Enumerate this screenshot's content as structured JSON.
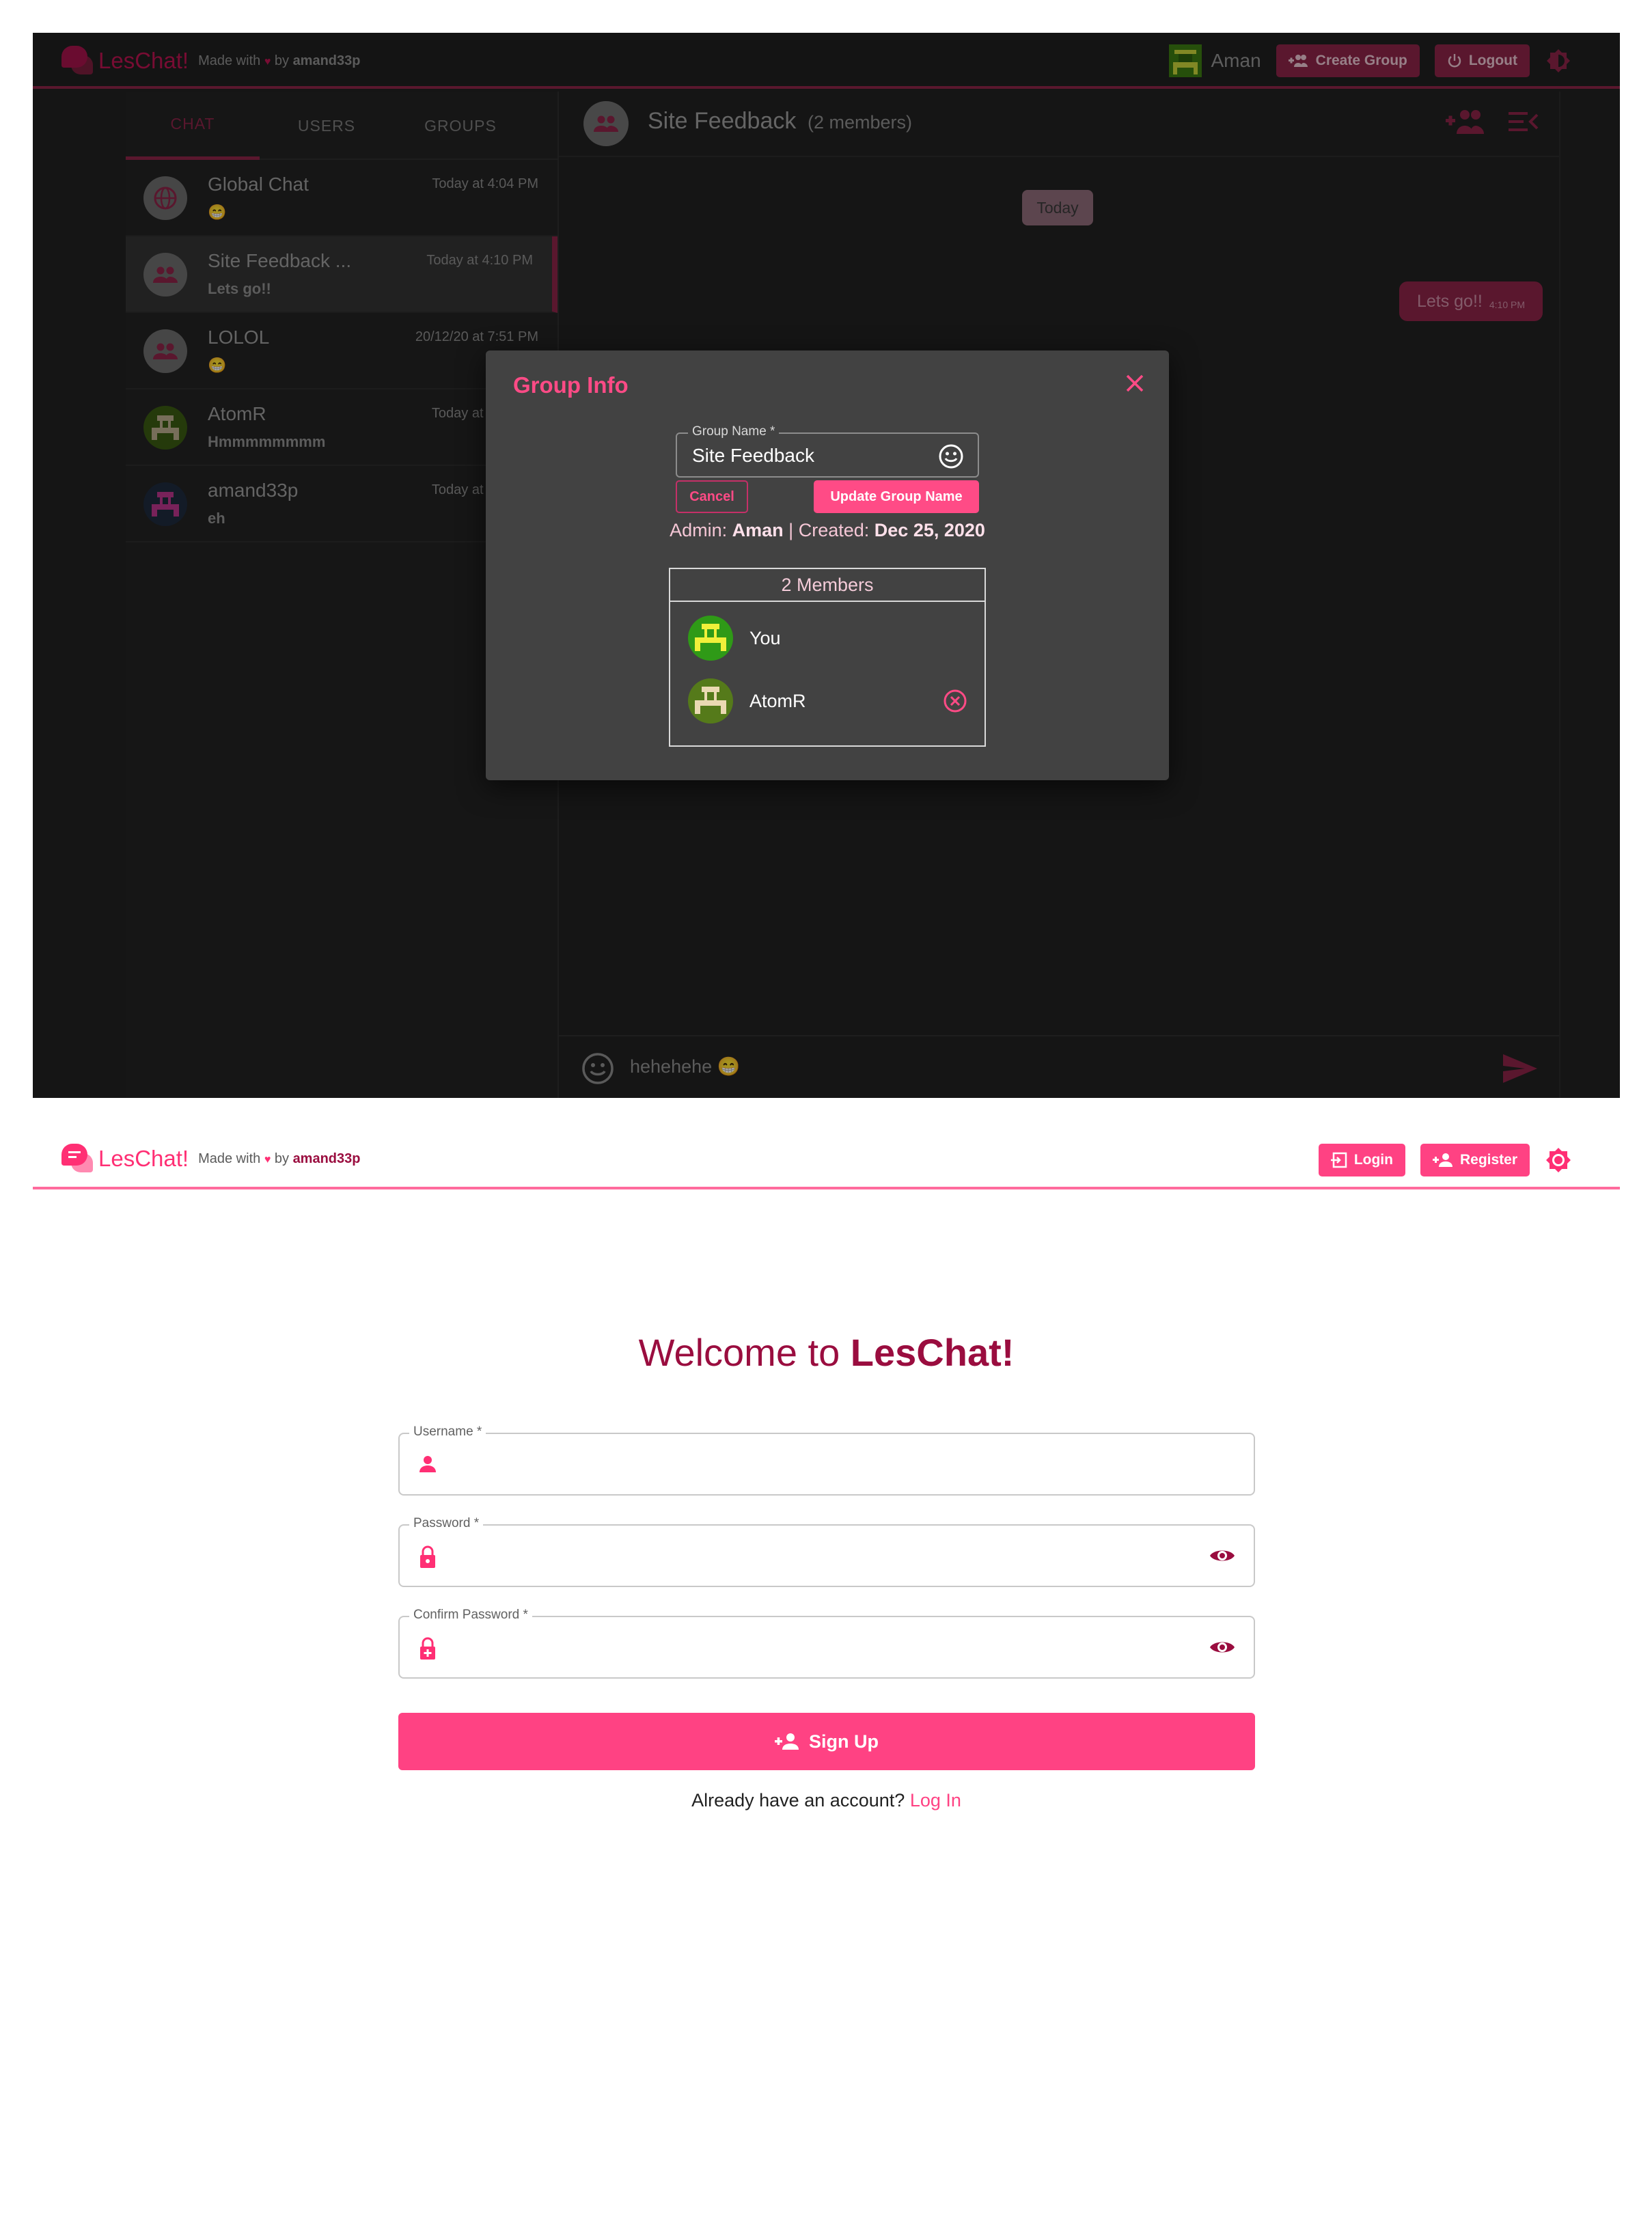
{
  "colors": {
    "brand": "#ff4283",
    "brand_dark": "#8a2447",
    "dark_bg": "#212121",
    "modal_bg": "#424242"
  },
  "dark_screen": {
    "brand": {
      "name": "LesChat!",
      "made_with": "Made with",
      "by": "by",
      "author": "amand33p"
    },
    "user": {
      "name": "Aman"
    },
    "buttons": {
      "create_group": "Create Group",
      "logout": "Logout"
    },
    "tabs": [
      {
        "label": "CHAT"
      },
      {
        "label": "USERS"
      },
      {
        "label": "GROUPS"
      }
    ],
    "chats": [
      {
        "name": "Global Chat",
        "time": "Today at 4:04 PM",
        "preview": "😁",
        "icon": "globe-icon"
      },
      {
        "name": "Site Feedback ...",
        "time": "Today at 4:10 PM",
        "preview": "Lets go!!",
        "icon": "group-icon"
      },
      {
        "name": "LOLOL",
        "time": "20/12/20 at 7:51 PM",
        "preview": "😁",
        "icon": "group-icon"
      },
      {
        "name": "AtomR",
        "time": "Today at 4:03",
        "preview": "Hmmmmmmmm",
        "icon": "pixel-avatar"
      },
      {
        "name": "amand33p",
        "time": "Today at 3:18",
        "preview": "eh",
        "icon": "pixel-avatar"
      }
    ],
    "chat_header": {
      "title": "Site Feedback",
      "members": "(2 members)"
    },
    "date_chip": "Today",
    "message": {
      "text": "Lets go!!",
      "time": "4:10 PM"
    },
    "input_text": "hehehehe",
    "modal": {
      "title": "Group Info",
      "field_label": "Group Name *",
      "field_value": "Site Feedback",
      "cancel": "Cancel",
      "update": "Update Group Name",
      "admin_label": "Admin:",
      "admin": "Aman",
      "separator": "|",
      "created_label": "Created:",
      "created": "Dec 25, 2020",
      "members_title": "2 Members",
      "members": [
        {
          "name": "You"
        },
        {
          "name": "AtomR"
        }
      ]
    }
  },
  "light_screen": {
    "brand": {
      "name": "LesChat!",
      "made_with": "Made with",
      "by": "by",
      "author": "amand33p"
    },
    "buttons": {
      "login": "Login",
      "register": "Register"
    },
    "welcome_prefix": "Welcome to",
    "welcome_brand": "LesChat!",
    "fields": {
      "username": "Username *",
      "password": "Password *",
      "confirm_password": "Confirm Password *"
    },
    "signup": "Sign Up",
    "have_account": "Already have an account?",
    "login_link": "Log In"
  }
}
